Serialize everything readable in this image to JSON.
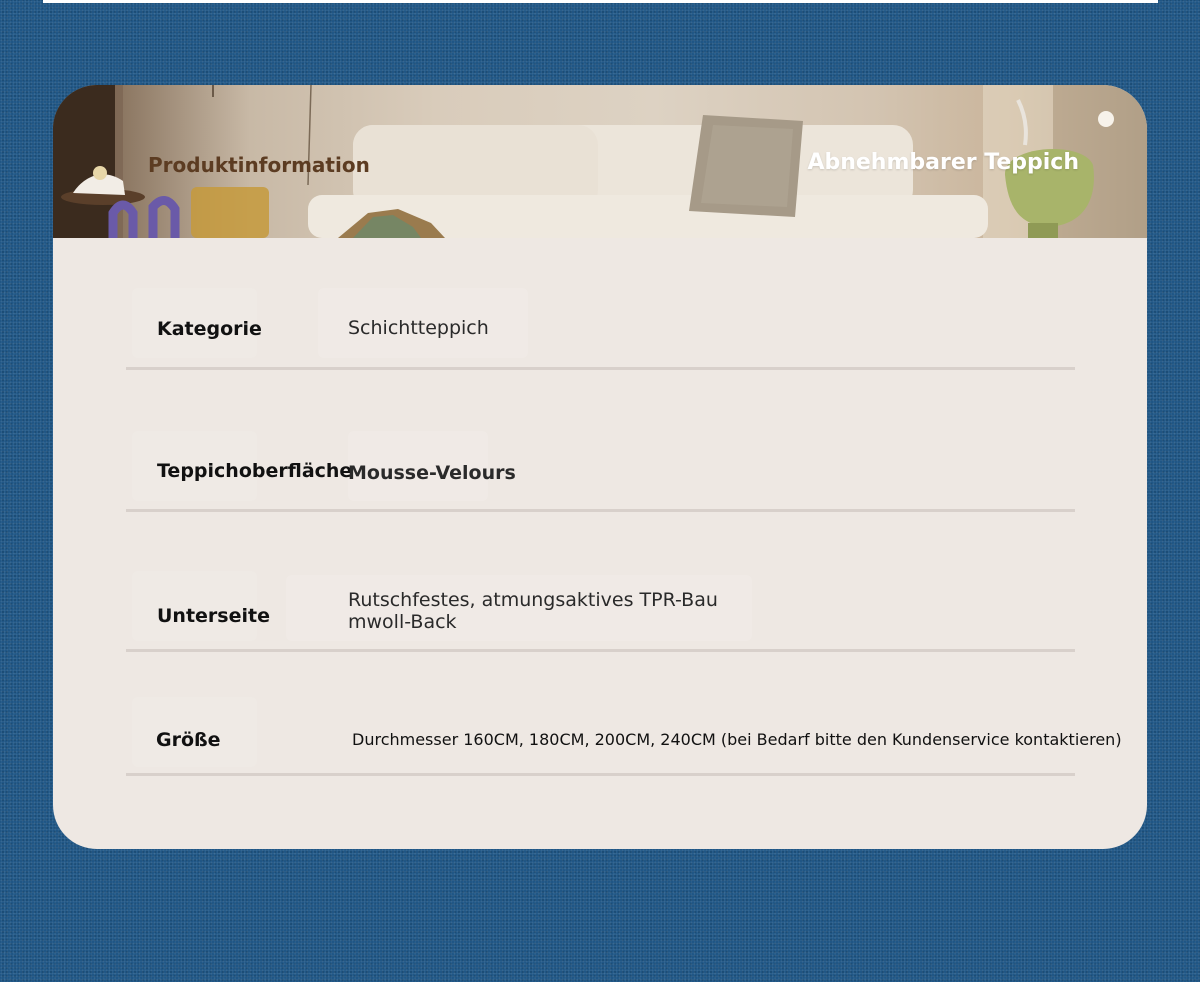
{
  "banner": {
    "left_title": "Produktinformation",
    "right_title": "Abnehmbarer Teppich"
  },
  "specs": [
    {
      "label": "Kategorie",
      "value": "Schichtteppich"
    },
    {
      "label": "Teppichoberfläche",
      "value": "Mousse-Velours"
    },
    {
      "label": "Unterseite",
      "value_line1": "Rutschfestes, atmungsaktives TPR-Bau",
      "value_line2": "mwoll-Back"
    },
    {
      "label": "Größe",
      "value": "Durchmesser 160CM, 180CM, 200CM, 240CM (bei Bedarf bitte den Kundenservice kontaktieren)"
    }
  ],
  "colors": {
    "background": "#1f5685",
    "card": "#eee8e3",
    "divider": "#d8d0cb",
    "banner_left_title": "#5c3c22",
    "banner_right_title": "#ffffff"
  }
}
